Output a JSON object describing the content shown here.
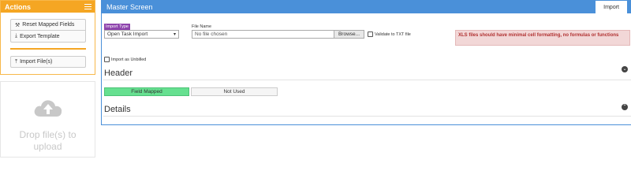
{
  "actions": {
    "title": "Actions",
    "buttons": [
      {
        "label": "Reset Mapped Fields",
        "icon": "wrench-icon",
        "glyph": "⚒"
      },
      {
        "label": "Export Template",
        "icon": "download-icon",
        "glyph": "⤓"
      },
      {
        "label": "Import File(s)",
        "icon": "upload-icon",
        "glyph": "⤒"
      }
    ],
    "accent": "#f5a623"
  },
  "dropzone": {
    "text": "Drop file(s) to upload",
    "icon": "cloud-upload-icon"
  },
  "main": {
    "title": "Master Screen",
    "tab_label": "Import",
    "accent": "#4a90d9",
    "import_type": {
      "label": "Import Type",
      "selected": "Open Task Import"
    },
    "file": {
      "label": "File Name",
      "placeholder": "No file chosen",
      "browse_label": "Browse..."
    },
    "validate_label": "Validate to TXT file",
    "alert_text": "XLS files should have minimal cell formatting, no formulas or functions",
    "unbilled_label": "Import as Unbilled",
    "sections": {
      "header": "Header",
      "details": "Details"
    },
    "legend": {
      "mapped": "Field Mapped",
      "not_used": "Not Used"
    }
  }
}
